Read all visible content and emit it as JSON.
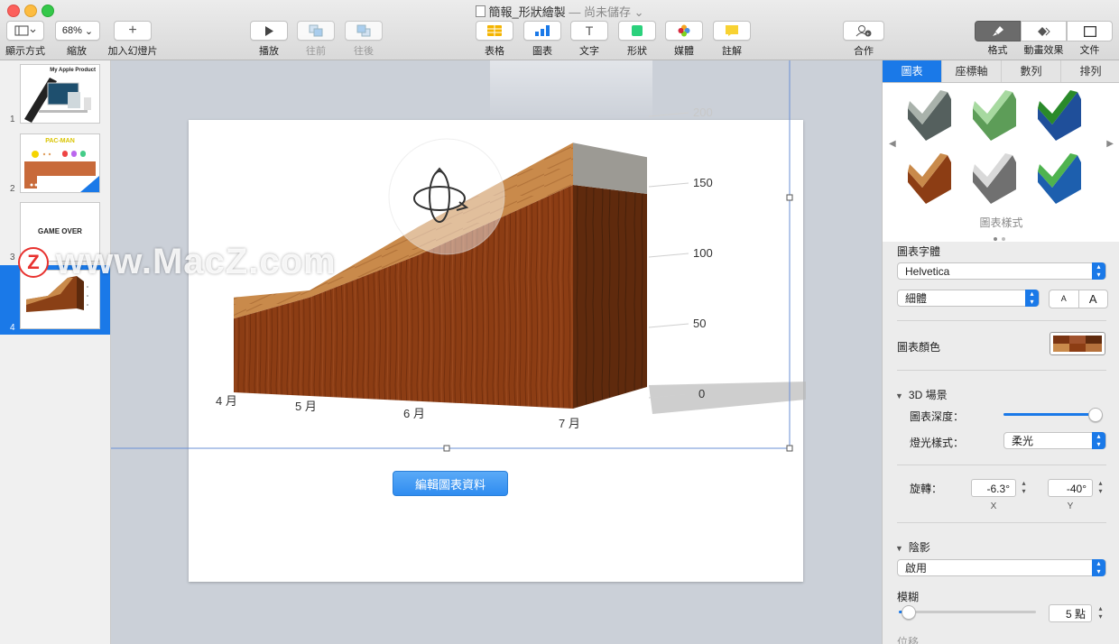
{
  "window": {
    "title": "簡報_形狀繪製",
    "status": "— 尚未儲存",
    "colors": {
      "accent": "#1a79e8",
      "close": "#fc605c",
      "minimize": "#fdbc40",
      "maximize": "#34c84a"
    }
  },
  "toolbar": {
    "view_label": "顯示方式",
    "zoom_value": "68%",
    "zoom_label": "縮放",
    "add_slide_label": "加入幻燈片",
    "play_label": "播放",
    "forward_label": "往前",
    "backward_label": "往後",
    "table_label": "表格",
    "chart_label": "圖表",
    "text_label": "文字",
    "shape_label": "形狀",
    "media_label": "媒體",
    "comment_label": "註解",
    "collaborate_label": "合作",
    "format_label": "格式",
    "animate_label": "動畫效果",
    "document_label": "文件"
  },
  "slides": [
    {
      "number": "1",
      "title": "My Apple Product"
    },
    {
      "number": "2",
      "title": "PAC-MAN"
    },
    {
      "number": "3",
      "title": "GAME OVER"
    },
    {
      "number": "4",
      "title": ""
    }
  ],
  "canvas": {
    "edit_chart_button": "編輯圖表資料",
    "watermark": "www.MacZ.com",
    "watermark_logo": "Z"
  },
  "chart_data": {
    "type": "area",
    "style": "3d",
    "categories": [
      "4 月",
      "5 月",
      "6 月",
      "7 月"
    ],
    "series": [
      {
        "values": [
          70,
          75,
          120,
          180
        ]
      },
      {
        "values": [
          55,
          70,
          100,
          150
        ]
      }
    ],
    "yticks": [
      "0",
      "50",
      "100",
      "150",
      "200"
    ],
    "ylim": [
      0,
      200
    ],
    "colors": {
      "wood_light": "#c98a4b",
      "wood_dark": "#7a3412"
    }
  },
  "inspector": {
    "tabs": [
      "圖表",
      "座標軸",
      "數列",
      "排列"
    ],
    "chart_styles_label": "圖表樣式",
    "chart_font_label": "圖表字體",
    "font_family": "Helvetica",
    "font_weight": "細體",
    "font_smaller": "A",
    "font_larger": "A",
    "chart_colors_label": "圖表顏色",
    "scene3d_label": "3D 場景",
    "chart_depth_label": "圖表深度：",
    "chart_depth_level": 0.95,
    "lighting_label": "燈光樣式：",
    "lighting_value": "柔光",
    "rotation_label": "旋轉：",
    "rotation_x": "-6.3°",
    "rotation_y": "-40°",
    "x_label": "X",
    "y_label": "Y",
    "shadow_label": "陰影",
    "shadow_value": "啟用",
    "blur_label": "模糊",
    "blur_value": "5 點",
    "blur_level": 0.05,
    "offset_label": "位移"
  }
}
